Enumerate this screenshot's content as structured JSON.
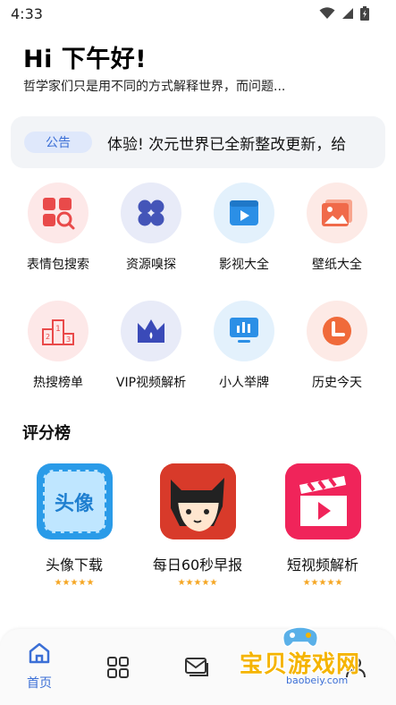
{
  "status_bar": {
    "time": "4:33"
  },
  "header": {
    "greeting": "Hi 下午好!",
    "subtitle": "哲学家们只是用不同的方式解释世界，而问题..."
  },
  "notice": {
    "badge": "公告",
    "text": "体验!    次元世界已全新整改更新，给"
  },
  "grid": {
    "items": [
      {
        "label": "表情包搜索",
        "icon": "meme-search-icon",
        "bg": "#fde8e8",
        "color": "#e94a4a"
      },
      {
        "label": "资源嗅探",
        "icon": "clover-icon",
        "bg": "#e8ebf8",
        "color": "#4455b8"
      },
      {
        "label": "影视大全",
        "icon": "video-player-icon",
        "bg": "#e3f1fc",
        "color": "#2b8fe6"
      },
      {
        "label": "壁纸大全",
        "icon": "wallpaper-image-icon",
        "bg": "#fdeae6",
        "color": "#f06a4a"
      },
      {
        "label": "热搜榜单",
        "icon": "podium-icon",
        "bg": "#fde8e8",
        "color": "#e94a4a"
      },
      {
        "label": "VIP视频解析",
        "icon": "crown-icon",
        "bg": "#e8ebf8",
        "color": "#3a4ab8"
      },
      {
        "label": "小人举牌",
        "icon": "sign-board-icon",
        "bg": "#e3f1fc",
        "color": "#2b8fe6"
      },
      {
        "label": "历史今天",
        "icon": "clock-icon",
        "bg": "#fdeae6",
        "color": "#f06a3a"
      }
    ]
  },
  "ranking": {
    "title": "评分榜",
    "items": [
      {
        "label": "头像下载",
        "stars": "★★★★★",
        "icon_text": "头像"
      },
      {
        "label": "每日60秒早报",
        "stars": "★★★★★"
      },
      {
        "label": "短视频解析",
        "stars": "★★★★★"
      }
    ]
  },
  "bottom_nav": {
    "items": [
      {
        "label": "首页",
        "icon": "home-icon"
      },
      {
        "label": "",
        "icon": "apps-grid-icon"
      },
      {
        "label": "",
        "icon": "messages-icon"
      },
      {
        "label": "",
        "icon": "user-icon"
      }
    ]
  },
  "watermark": {
    "text": "宝贝游戏网",
    "url": "baobeiy.com"
  },
  "colors": {
    "accent": "#3b6fd6",
    "star": "#f5a623"
  }
}
